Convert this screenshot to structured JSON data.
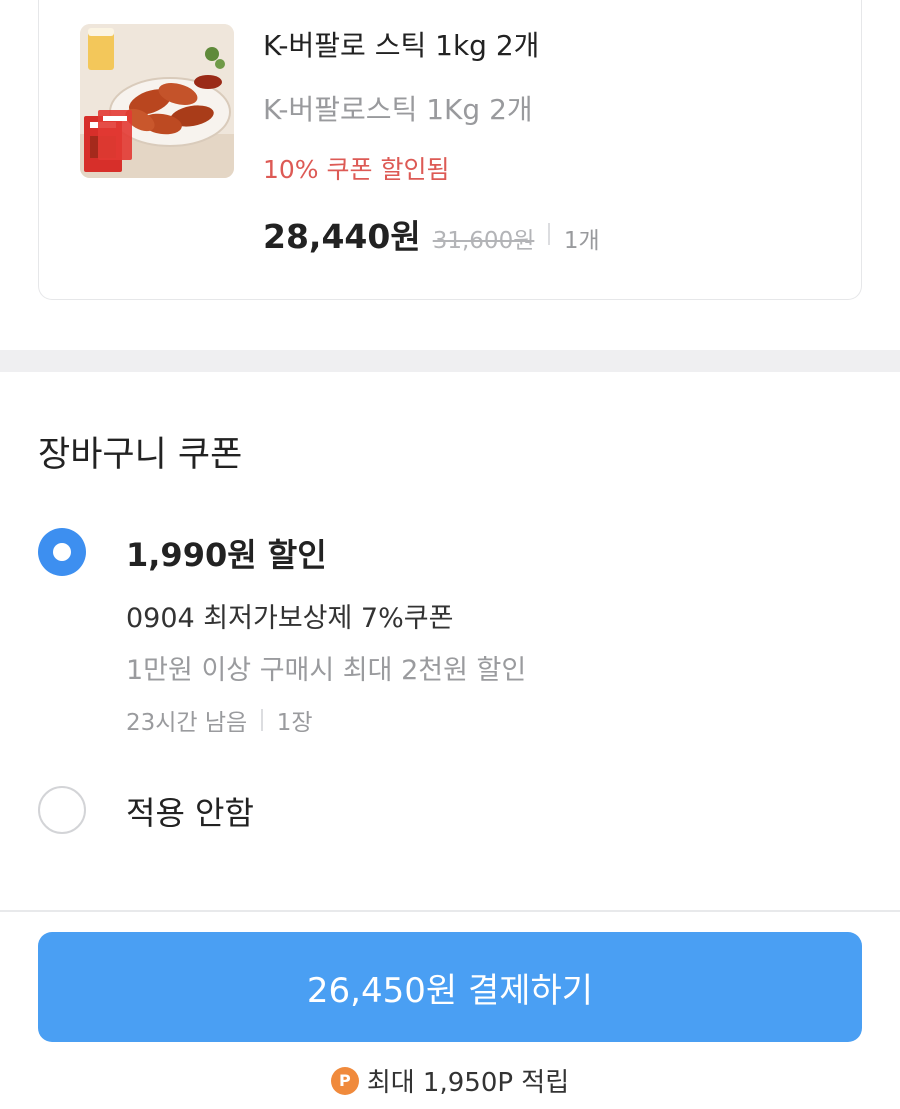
{
  "product": {
    "name": "K-버팔로 스틱 1kg 2개",
    "option": "K-버팔로스틱 1Kg 2개",
    "coupon_applied": "10% 쿠폰 할인됨",
    "price": "28,440원",
    "original_price": "31,600원",
    "quantity": "1개",
    "image_label": "K-버팔로 스틱"
  },
  "cart_coupon": {
    "title": "장바구니 쿠폰",
    "options": [
      {
        "amount": "1,990원 할인",
        "name": "0904 최저가보상제 7%쿠폰",
        "condition": "1만원 이상 구매시 최대 2천원 할인",
        "time_left": "23시간 남음",
        "count": "1장",
        "selected": true
      },
      {
        "label": "적용 안함",
        "selected": false
      }
    ]
  },
  "checkout": {
    "pay_button_label": "26,450원 결제하기",
    "point_icon_letter": "P",
    "points_text": "최대 1,950P 적립"
  },
  "colors": {
    "accent_blue": "#4a9ff3",
    "radio_blue": "#3d8ff0",
    "discount_red": "#dd5a55",
    "point_orange": "#f08a3c"
  },
  "icons": {
    "product_image": "chicken-wings-thumbnail",
    "radio_selected": "radio-checked-icon",
    "radio_unselected": "radio-unchecked-icon",
    "point": "point-coin-icon"
  }
}
